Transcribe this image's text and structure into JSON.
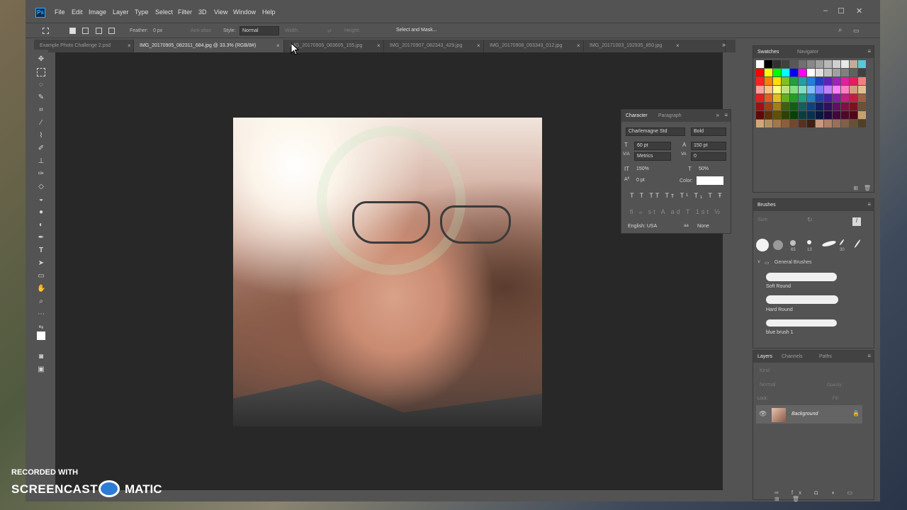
{
  "menubar": {
    "logo": "Ps",
    "items": [
      "File",
      "Edit",
      "Image",
      "Layer",
      "Type",
      "Select",
      "Filter",
      "3D",
      "View",
      "Window",
      "Help"
    ],
    "window_controls": [
      "–",
      "☐",
      "✕"
    ]
  },
  "options_bar": {
    "feather_label": "Feather:",
    "feather_value": "0 px",
    "antialias_label": "Anti-alias",
    "style_label": "Style:",
    "style_value": "Normal",
    "width_label": "Width:",
    "height_label": "Height:",
    "select_mask_button": "Select and Mask..."
  },
  "tabs": [
    {
      "label": "Example Photo Challenge 2.psd",
      "active": false
    },
    {
      "label": "IMG_20170905_082311_684.jpg @ 33.3% (RGB/8#)",
      "active": true
    },
    {
      "label": "IMG_20170906_083605_155.jpg",
      "active": false
    },
    {
      "label": "IMG_20170907_082343_429.jpg",
      "active": false
    },
    {
      "label": "IMG_20170908_093343_012.jpg",
      "active": false
    },
    {
      "label": "IMG_20171003_192935_850.jpg",
      "active": false
    }
  ],
  "tabs_overflow": "»",
  "swatches_panel": {
    "tabs": [
      "Swatches",
      "Navigator"
    ],
    "colors": [
      "#ffffff",
      "#000000",
      "#303030",
      "#404040",
      "#585858",
      "#707070",
      "#888888",
      "#a0a0a0",
      "#b8b8b8",
      "#d0d0d0",
      "#e8e8e8",
      "#c8a898",
      "#5ac8d8",
      "#ff0000",
      "#ffff00",
      "#00ff00",
      "#00ffff",
      "#0000ff",
      "#ff00ff",
      "#ffffff",
      "#e0e0e0",
      "#c0c0c0",
      "#a0a0a0",
      "#808080",
      "#606060",
      "#404040",
      "#ff2020",
      "#ff8000",
      "#ffe000",
      "#80c020",
      "#20a040",
      "#20a0a0",
      "#2080e0",
      "#2040c0",
      "#6020c0",
      "#a020c0",
      "#e020a0",
      "#e02060",
      "#f08080",
      "#ffa0a0",
      "#ffc080",
      "#ffff80",
      "#c0e080",
      "#80e080",
      "#80e0c0",
      "#80c0ff",
      "#8080ff",
      "#c080ff",
      "#ff80ff",
      "#ff80c0",
      "#d0a080",
      "#e0c090",
      "#e02020",
      "#e06020",
      "#e0c020",
      "#60b020",
      "#20a020",
      "#20a080",
      "#2080c0",
      "#2040a0",
      "#4020a0",
      "#8020a0",
      "#c02080",
      "#c02040",
      "#a06040",
      "#a01010",
      "#a04010",
      "#a08010",
      "#406010",
      "#106010",
      "#106060",
      "#104080",
      "#102060",
      "#301060",
      "#601060",
      "#801040",
      "#801020",
      "#705030",
      "#600808",
      "#603008",
      "#605008",
      "#304008",
      "#084008",
      "#084040",
      "#083050",
      "#081840",
      "#200840",
      "#400840",
      "#500828",
      "#500818",
      "#c8a070",
      "#d0a878",
      "#b89060",
      "#a07850",
      "#886040",
      "#704830",
      "#583020",
      "#402010",
      "#c89880",
      "#b08068",
      "#987058",
      "#806048",
      "#685038",
      "#504028"
    ]
  },
  "character_panel": {
    "tabs": [
      "Character",
      "Paragraph"
    ],
    "font_family": "Charlemagne Std",
    "font_style": "Bold",
    "font_size": "60 pt",
    "leading": "150 pt",
    "kerning": "Metrics",
    "tracking": "0",
    "vertical_scale": "150%",
    "horizontal_scale": "50%",
    "baseline_shift": "0 pt",
    "color_label": "Color:",
    "language": "English: USA",
    "antialias": "None"
  },
  "brushes_panel": {
    "title": "Brushes",
    "size_label": "Size:",
    "presets": [
      {
        "size": ""
      },
      {
        "size": ""
      },
      {
        "size": "65"
      },
      {
        "size": "13"
      },
      {
        "size": ""
      },
      {
        "size": "30"
      },
      {
        "size": ""
      }
    ],
    "folder": "General Brushes",
    "brushes": [
      "Soft Round",
      "Hard Round",
      "blue brush 1"
    ]
  },
  "layers_panel": {
    "tabs": [
      "Layers",
      "Channels",
      "Paths"
    ],
    "kind_placeholder": "Kind",
    "blend_mode": "Normal",
    "opacity_label": "Opacity:",
    "lock_label": "Lock:",
    "fill_label": "Fill:",
    "layer_name": "Background"
  },
  "watermark": {
    "line1": "RECORDED WITH",
    "word1": "SCREENCAST",
    "word2": "MATIC"
  }
}
